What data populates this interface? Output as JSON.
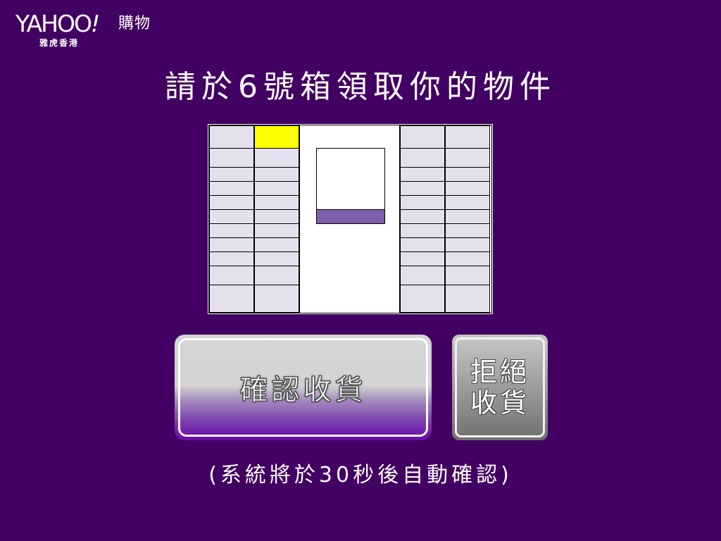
{
  "logo": {
    "brand": "YAHOO",
    "exclamation": "!",
    "service": "購物",
    "region": "雅虎香港"
  },
  "heading": "請於6號箱領取你的物件",
  "locker": {
    "target_box_number": 6,
    "colors": {
      "cell": "#e4e0ee",
      "target": "#ffff00",
      "screen_bar": "#7b5fa8",
      "border": "#000000"
    }
  },
  "buttons": {
    "confirm_label": "確認收貨",
    "reject_line1": "拒絕",
    "reject_line2": "收貨"
  },
  "note": "(系統將於30秒後自動確認)",
  "colors": {
    "background": "#420062",
    "text": "#ffffff"
  }
}
